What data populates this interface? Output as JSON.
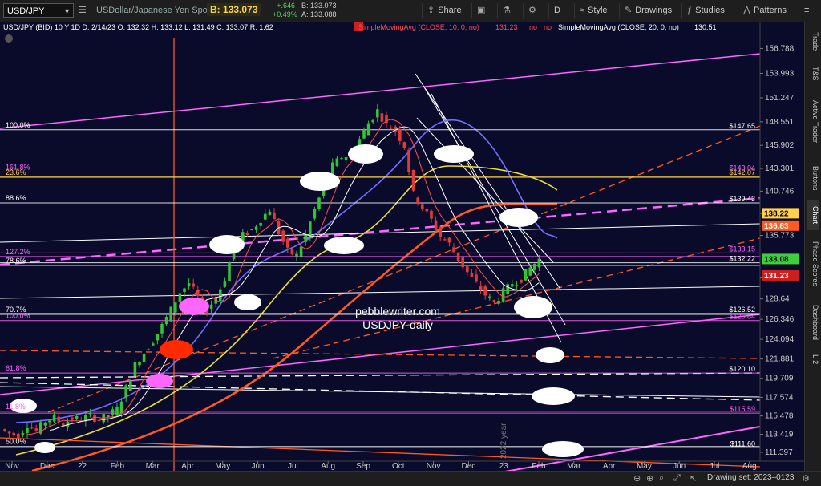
{
  "toolbar": {
    "symbol": "USD/JPY",
    "description": "USDollar/Japanese Yen Spot",
    "bid_label": "B: 133.073",
    "change_abs": "+.646",
    "change_pct": "+0.49%",
    "bid_small": "B: 133.073",
    "ask_small": "A: 133.088",
    "share_label": "Share",
    "period_label": "D",
    "style_label": "Style",
    "drawings_label": "Drawings",
    "studies_label": "Studies",
    "patterns_label": "Patterns"
  },
  "legend": {
    "ohlc": "USD/JPY (BID) 10 Y 1D  D: 2/14/23  O: 132.32  H: 133.12  L: 131.49  C: 133.07  R: 1.62",
    "sma1": "SimpleMovingAvg (CLOSE, 10, 0, no)",
    "sma1_val": "131.23",
    "no1": "no",
    "no2": "no",
    "sma2": "SimpleMovingAvg (CLOSE, 20, 0, no)",
    "sma2_val": "130.51"
  },
  "sidebar": [
    "Trade",
    "T&S",
    "Active Trader",
    "Buttons",
    "Chart",
    "Phase Scores",
    "Dashboard",
    "L 2"
  ],
  "watermark": {
    "line1": "pebblewriter.com",
    "line2": "USDJPY daily",
    "year": "2022 year"
  },
  "fib_labels_left": [
    {
      "text": "100.0%",
      "price": 147.65,
      "color": "#ffffff"
    },
    {
      "text": "161.8%",
      "price": 142.9,
      "color": "#ff66ff"
    },
    {
      "text": "23.6%",
      "price": 142.3,
      "color": "#ffd24a"
    },
    {
      "text": "88.6%",
      "price": 139.43,
      "color": "#ffffff"
    },
    {
      "text": "127.2%",
      "price": 133.4,
      "color": "#ff66ff"
    },
    {
      "text": "78.6%",
      "price": 132.4,
      "color": "#ffffff"
    },
    {
      "text": "70.7%",
      "price": 126.9,
      "color": "#ffffff"
    },
    {
      "text": "100.0%",
      "price": 126.2,
      "color": "#ff66ff"
    },
    {
      "text": "61.8%",
      "price": 120.3,
      "color": "#ff66ff"
    },
    {
      "text": "11.8%",
      "price": 116.0,
      "color": "#ff66ff"
    },
    {
      "text": "50.0%",
      "price": 112.05,
      "color": "#ffffff"
    }
  ],
  "level_labels_right": [
    {
      "text": "$147.65",
      "price": 147.65,
      "color": "#ffffff"
    },
    {
      "text": "$143.04",
      "price": 142.9,
      "color": "#ff66ff"
    },
    {
      "text": "$142.07",
      "price": 142.4,
      "color": "#ffd24a"
    },
    {
      "text": "$139.43",
      "price": 139.43,
      "color": "#ffffff"
    },
    {
      "text": "$133.15",
      "price": 133.8,
      "color": "#ff66ff"
    },
    {
      "text": "$132.22",
      "price": 132.7,
      "color": "#ffffff"
    },
    {
      "text": "$126.52",
      "price": 127.0,
      "color": "#ffffff"
    },
    {
      "text": "$125.84",
      "price": 126.2,
      "color": "#ff66ff"
    },
    {
      "text": "$120.10",
      "price": 120.3,
      "color": "#ffffff"
    },
    {
      "text": "$115.59",
      "price": 115.8,
      "color": "#ff66ff"
    },
    {
      "text": "$111.60",
      "price": 111.9,
      "color": "#ffffff"
    }
  ],
  "price_badges": [
    {
      "text": "138.22",
      "price": 138.22,
      "bg": "#ffd24a",
      "fg": "#000000"
    },
    {
      "text": "136.83",
      "price": 136.83,
      "bg": "#ff5a1f",
      "fg": "#ffffff"
    },
    {
      "text": "133.08",
      "price": 133.08,
      "bg": "#3cd13c",
      "fg": "#000000"
    },
    {
      "text": "131.23",
      "price": 131.23,
      "bg": "#cc1f1f",
      "fg": "#ffffff"
    }
  ],
  "bottom": {
    "drawing_set": "Drawing set: 2023–0123"
  },
  "chart_data": {
    "type": "candlestick",
    "yaxis": {
      "ticks": [
        156.788,
        153.993,
        151.247,
        148.551,
        145.902,
        143.301,
        140.746,
        138.237,
        135.773,
        133.354,
        130.979,
        128.64,
        126.346,
        124.094,
        121.881,
        119.709,
        117.574,
        115.478,
        113.419,
        111.397
      ],
      "tick_labels": [
        "156.788",
        "153.993",
        "151.247",
        "148.551",
        "145.902",
        "143.301",
        "140.746",
        "138.237",
        "135.773",
        "133.354",
        "130.979",
        "128.64",
        "126.346",
        "124.094",
        "121.881",
        "119.709",
        "117.574",
        "115.478",
        "113.419",
        "111.397"
      ],
      "range": [
        110.4,
        158.0
      ]
    },
    "xaxis": {
      "labels": [
        "Nov",
        "Dec",
        "22",
        "Feb",
        "Mar",
        "Apr",
        "May",
        "Jun",
        "Jul",
        "Aug",
        "Sep",
        "Oct",
        "Nov",
        "Dec",
        "23",
        "Feb",
        "Mar",
        "Apr",
        "May",
        "Jun",
        "Jul",
        "Aug"
      ]
    },
    "price_path": [
      [
        0,
        114.0
      ],
      [
        2,
        113.5
      ],
      [
        4,
        113.2
      ],
      [
        6,
        114.5
      ],
      [
        8,
        113.8
      ],
      [
        10,
        114.9
      ],
      [
        12,
        115.3
      ],
      [
        14,
        114.6
      ],
      [
        16,
        115.2
      ],
      [
        18,
        115.1
      ],
      [
        20,
        115.5
      ],
      [
        22,
        115.0
      ],
      [
        24,
        115.6
      ],
      [
        26,
        116.2
      ],
      [
        28,
        118.6
      ],
      [
        30,
        121.2
      ],
      [
        32,
        122.6
      ],
      [
        34,
        124.0
      ],
      [
        36,
        125.6
      ],
      [
        38,
        127.4
      ],
      [
        40,
        129.4
      ],
      [
        42,
        130.4
      ],
      [
        44,
        128.8
      ],
      [
        46,
        127.4
      ],
      [
        48,
        128.8
      ],
      [
        50,
        130.9
      ],
      [
        52,
        134.5
      ],
      [
        54,
        135.8
      ],
      [
        56,
        136.4
      ],
      [
        58,
        137.6
      ],
      [
        60,
        138.7
      ],
      [
        62,
        136.1
      ],
      [
        64,
        134.0
      ],
      [
        66,
        133.5
      ],
      [
        68,
        135.8
      ],
      [
        70,
        138.7
      ],
      [
        72,
        141.2
      ],
      [
        74,
        143.6
      ],
      [
        76,
        144.6
      ],
      [
        78,
        144.8
      ],
      [
        80,
        146.6
      ],
      [
        82,
        148.4
      ],
      [
        84,
        149.8
      ],
      [
        86,
        148.2
      ],
      [
        88,
        147.6
      ],
      [
        90,
        145.8
      ],
      [
        92,
        140.4
      ],
      [
        94,
        138.9
      ],
      [
        96,
        137.5
      ],
      [
        98,
        135.7
      ],
      [
        100,
        134.8
      ],
      [
        102,
        133.1
      ],
      [
        104,
        131.6
      ],
      [
        106,
        130.3
      ],
      [
        108,
        129.1
      ],
      [
        110,
        128.2
      ],
      [
        112,
        129.4
      ],
      [
        114,
        130.4
      ],
      [
        116,
        130.9
      ],
      [
        118,
        132.1
      ],
      [
        120,
        133.1
      ]
    ],
    "series": [
      {
        "name": "SimpleMovingAvg (CLOSE, 10, 0, no)",
        "color": "#ff5050",
        "value_last": 131.23
      },
      {
        "name": "SimpleMovingAvg (CLOSE, 20, 0, no)",
        "color": "#ffffff",
        "value_last": 130.51
      }
    ]
  }
}
